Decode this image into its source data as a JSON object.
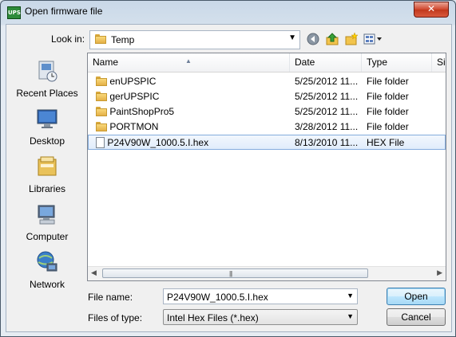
{
  "window": {
    "title": "Open firmware file",
    "app_icon_text": "UPS",
    "close_label": "✕"
  },
  "lookin": {
    "label": "Look in:",
    "value": "Temp"
  },
  "toolbar": {
    "back_icon": "back-icon",
    "up_icon": "up-folder-icon",
    "new_folder_icon": "new-folder-icon",
    "views_icon": "views-menu-icon"
  },
  "places": [
    {
      "label": "Recent Places",
      "icon": "recent-places-icon"
    },
    {
      "label": "Desktop",
      "icon": "desktop-icon"
    },
    {
      "label": "Libraries",
      "icon": "libraries-icon"
    },
    {
      "label": "Computer",
      "icon": "computer-icon"
    },
    {
      "label": "Network",
      "icon": "network-icon"
    }
  ],
  "columns": {
    "name": "Name",
    "date": "Date",
    "type": "Type",
    "size": "Size"
  },
  "files": [
    {
      "name": "enUPSPIC",
      "date": "5/25/2012 11...",
      "type": "File folder",
      "kind": "folder"
    },
    {
      "name": "gerUPSPIC",
      "date": "5/25/2012 11...",
      "type": "File folder",
      "kind": "folder"
    },
    {
      "name": "PaintShopPro5",
      "date": "5/25/2012 11...",
      "type": "File folder",
      "kind": "folder"
    },
    {
      "name": "PORTMON",
      "date": "3/28/2012 11...",
      "type": "File folder",
      "kind": "folder"
    },
    {
      "name": "P24V90W_1000.5.I.hex",
      "date": "8/13/2010 11...",
      "type": "HEX File",
      "kind": "file",
      "selected": true
    }
  ],
  "filename": {
    "label": "File name:",
    "value": "P24V90W_1000.5.I.hex"
  },
  "filetype": {
    "label": "Files of type:",
    "value": "Intel Hex Files (*.hex)"
  },
  "buttons": {
    "open": "Open",
    "cancel": "Cancel"
  },
  "colors": {
    "selection_border": "#84acdd",
    "title_bar": "#c9d8e8"
  }
}
